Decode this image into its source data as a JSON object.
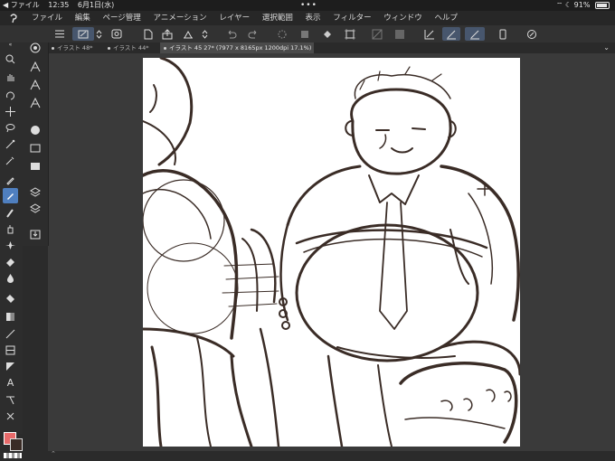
{
  "status_bar": {
    "app_back": "◀ ファイル",
    "time": "12:35",
    "date": "6月1日(水)",
    "battery": "91%",
    "battery_level": 0.91
  },
  "menu": [
    "ファイル",
    "編集",
    "ページ管理",
    "アニメーション",
    "レイヤー",
    "選択範囲",
    "表示",
    "フィルター",
    "ウィンドウ",
    "ヘルプ"
  ],
  "tabs": [
    {
      "label": "イラスト 48*",
      "active": false
    },
    {
      "label": "イラスト 44*",
      "active": false
    },
    {
      "label": "イラスト 45 27* (7977 x 8165px 1200dpi 17.1%)",
      "active": true
    }
  ],
  "toolbar_icons": [
    "menu-icon",
    "brush-settings-icon",
    "stepper-icon",
    "view-icon",
    "new-canvas-icon",
    "export-icon",
    "save-icon",
    "upload-icon",
    "undo-icon",
    "redo-icon",
    "loading-icon",
    "crop-icon",
    "fill-icon",
    "transform-icon",
    "clear-icon",
    "selection-icon",
    "ruler-icon",
    "pen-pressure-icon",
    "pen-icon",
    "smartphone-icon",
    "rotate-icon"
  ],
  "tool_icons": [
    "zoom-icon",
    "hand-icon",
    "rotate-view-icon",
    "move-icon",
    "lasso-icon",
    "magic-wand-icon",
    "eyedropper-icon",
    "pen-icon",
    "pencil-icon",
    "brush-icon",
    "airbrush-icon",
    "blend-icon",
    "eraser-icon",
    "fill-icon",
    "gradient-icon",
    "figure-icon",
    "frame-icon",
    "ruler-icon",
    "text-icon",
    "balloon-icon",
    "correct-line-icon"
  ],
  "colors": {
    "main": "#e86a6a",
    "sub": "#3a2c26",
    "accent": "#47566d"
  }
}
